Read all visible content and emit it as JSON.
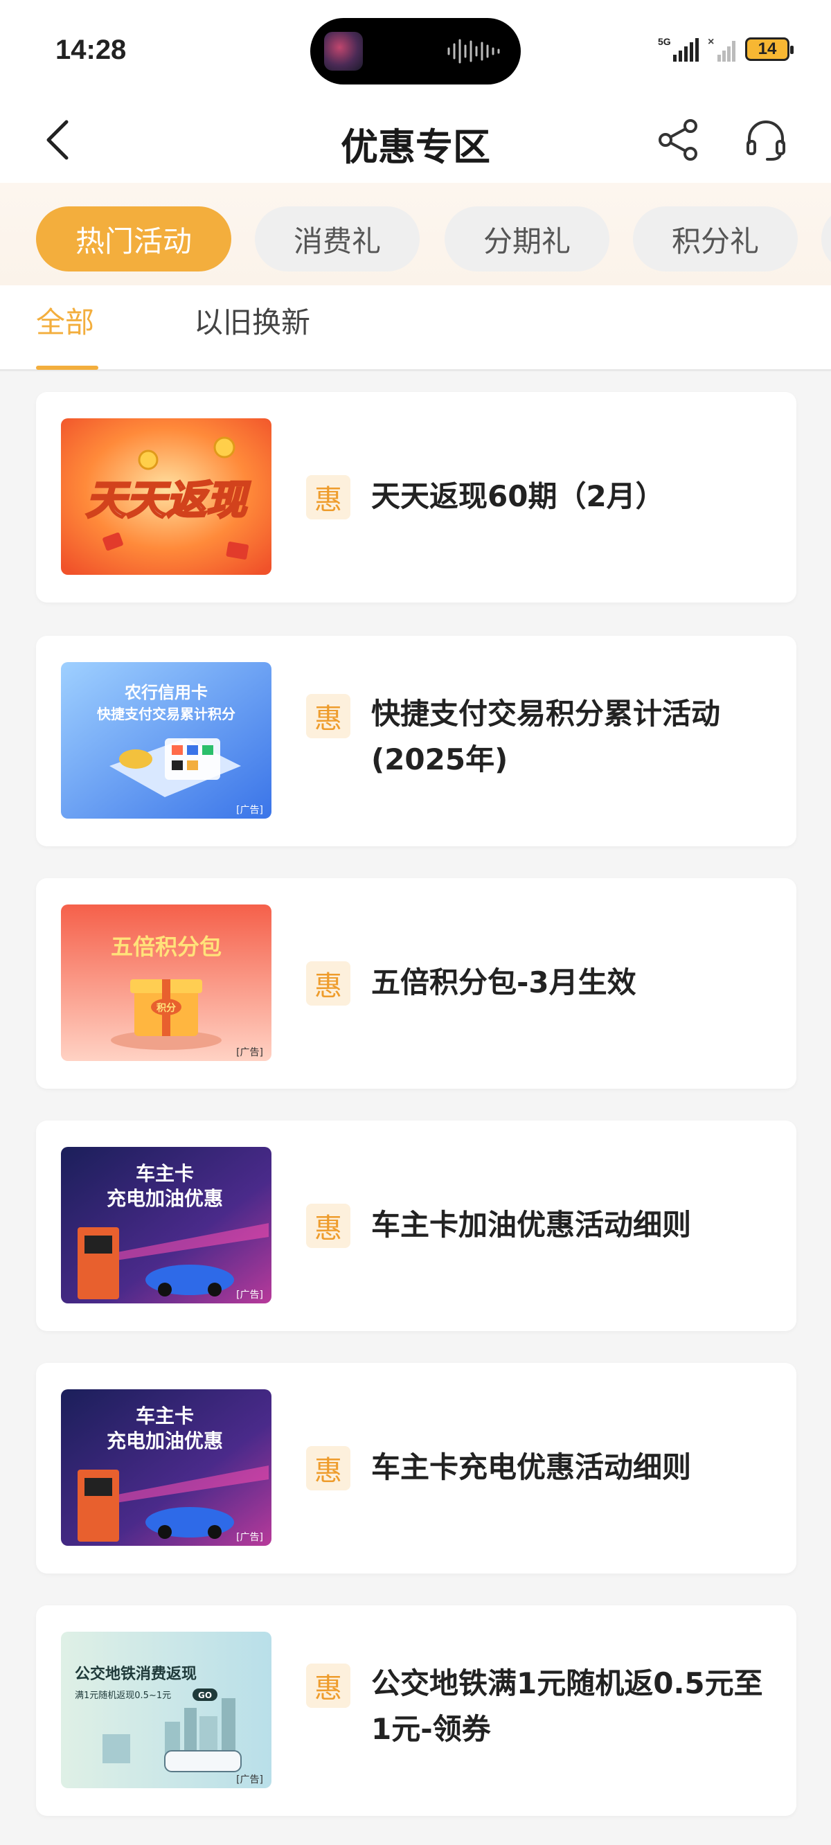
{
  "status_bar": {
    "time": "14:28",
    "network": "5G",
    "battery": "14",
    "icons": [
      "signal-icon",
      "no-signal-icon",
      "battery-icon"
    ]
  },
  "nav": {
    "title": "优惠专区",
    "icons": [
      "back-arrow-icon",
      "share-icon",
      "customer-service-icon"
    ]
  },
  "categories": [
    {
      "label": "热门活动",
      "active": true
    },
    {
      "label": "消费礼",
      "active": false
    },
    {
      "label": "分期礼",
      "active": false
    },
    {
      "label": "积分礼",
      "active": false
    }
  ],
  "sub_tabs": [
    {
      "label": "全部",
      "active": true
    },
    {
      "label": "以旧换新",
      "active": false
    }
  ],
  "badge_label": "惠",
  "accent_color": "#f3ae3d",
  "promotions": [
    {
      "title": "天天返现60期（2月）",
      "thumb": {
        "headline": "天天返现"
      }
    },
    {
      "title": "快捷支付交易积分累计活动(2025年)",
      "thumb": {
        "headline": "农行信用卡",
        "subline": "快捷支付交易累计积分",
        "tag": "[广告]"
      }
    },
    {
      "title": "五倍积分包-3月生效",
      "thumb": {
        "headline": "五倍积分包",
        "badge": "积分",
        "tag": "[广告]"
      }
    },
    {
      "title": "车主卡加油优惠活动细则",
      "thumb": {
        "headline": "车主卡",
        "subline": "充电加油优惠",
        "tag": "[广告]"
      }
    },
    {
      "title": "车主卡充电优惠活动细则",
      "thumb": {
        "headline": "车主卡",
        "subline": "充电加油优惠",
        "tag": "[广告]"
      }
    },
    {
      "title": "公交地铁满1元随机返0.5元至1元-领券",
      "thumb": {
        "headline": "公交地铁消费返现",
        "subline": "满1元随机返现0.5~1元",
        "button": "GO",
        "tag": "[广告]"
      }
    }
  ]
}
